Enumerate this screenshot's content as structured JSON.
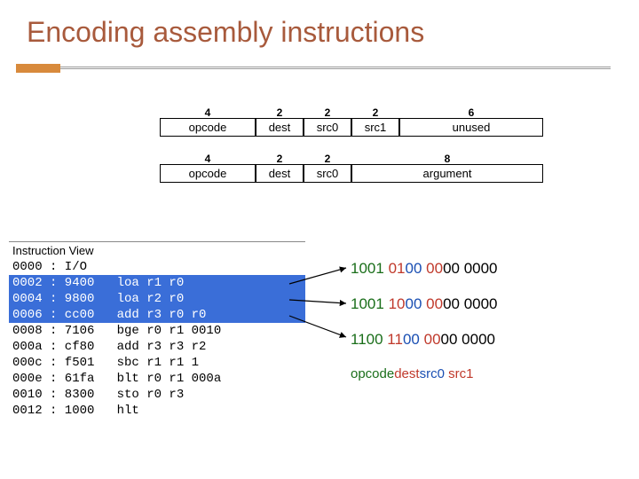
{
  "title": "Encoding assembly instructions",
  "encoding1": {
    "bits": [
      "4",
      "2",
      "2",
      "2",
      "6"
    ],
    "fields": [
      "opcode",
      "dest",
      "src0",
      "src1",
      "unused"
    ]
  },
  "encoding2": {
    "bits": [
      "4",
      "2",
      "2",
      "8"
    ],
    "fields": [
      "opcode",
      "dest",
      "src0",
      "argument"
    ]
  },
  "iv_header": "Instruction View",
  "instructions": [
    {
      "addr": "0000",
      "hex": "I/O",
      "mnem": "",
      "args": "",
      "sel": false
    },
    {
      "addr": "0002",
      "hex": "9400",
      "mnem": "loa",
      "args": "r1 r0",
      "sel": true
    },
    {
      "addr": "0004",
      "hex": "9800",
      "mnem": "loa",
      "args": "r2 r0",
      "sel": true
    },
    {
      "addr": "0006",
      "hex": "cc00",
      "mnem": "add",
      "args": "r3 r0 r0",
      "sel": true
    },
    {
      "addr": "0008",
      "hex": "7106",
      "mnem": "bge",
      "args": "r0 r1 0010",
      "sel": false
    },
    {
      "addr": "000a",
      "hex": "cf80",
      "mnem": "add",
      "args": "r3 r3 r2",
      "sel": false
    },
    {
      "addr": "000c",
      "hex": "f501",
      "mnem": "sbc",
      "args": "r1 r1 1",
      "sel": false
    },
    {
      "addr": "000e",
      "hex": "61fa",
      "mnem": "blt",
      "args": "r0 r1 000a",
      "sel": false
    },
    {
      "addr": "0010",
      "hex": "8300",
      "mnem": "sto",
      "args": "r0 r3",
      "sel": false
    },
    {
      "addr": "0012",
      "hex": "1000",
      "mnem": "hlt",
      "args": "",
      "sel": false
    }
  ],
  "binrows": [
    {
      "op": "1001",
      "dest": "01",
      "src0": "00",
      "src1": "00",
      "rest": "00 0000"
    },
    {
      "op": "1001",
      "dest": "10",
      "src0": "00",
      "src1": "00",
      "rest": "00 0000"
    },
    {
      "op": "1100",
      "dest": "11",
      "src0": "00",
      "src1": "00",
      "rest": "00 0000"
    }
  ],
  "legend": {
    "op": "opcode",
    "dest": "dest",
    "src0": "src0",
    "src1": "src1"
  },
  "chart_data": [
    {
      "type": "table",
      "title": "Instruction format (register form)",
      "categories": [
        "opcode",
        "dest",
        "src0",
        "src1",
        "unused"
      ],
      "values": [
        4,
        2,
        2,
        2,
        6
      ]
    },
    {
      "type": "table",
      "title": "Instruction format (immediate form)",
      "categories": [
        "opcode",
        "dest",
        "src0",
        "argument"
      ],
      "values": [
        4,
        2,
        2,
        8
      ]
    }
  ]
}
